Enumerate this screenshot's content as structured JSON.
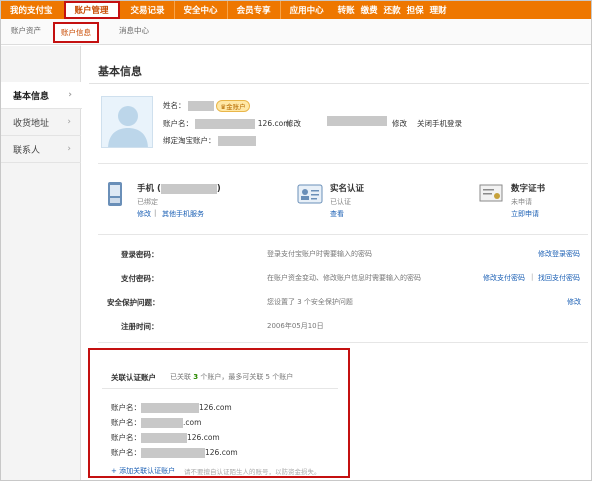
{
  "topnav": {
    "items": [
      "我的支付宝",
      "账户管理",
      "交易记录",
      "安全中心",
      "会员专享",
      "应用中心"
    ],
    "quick": [
      "转账",
      "缴费",
      "还款",
      "担保",
      "理财"
    ]
  },
  "subnav": {
    "items": [
      "账户资产",
      "账户信息",
      "消息中心"
    ]
  },
  "sidebar": {
    "items": [
      "基本信息",
      "收货地址",
      "联系人"
    ]
  },
  "page": {
    "title": "基本信息"
  },
  "profile": {
    "name_label": "姓名：",
    "level_badge": "金账户",
    "account_label": "账户名：",
    "account_suffix": "126.com",
    "modify": "修改",
    "close_phone_login": "关闭手机登录",
    "taobao_label": "绑定淘宝账户："
  },
  "features": {
    "phone": {
      "title": "手机 (",
      "title_end": ")",
      "status": "已绑定",
      "link1": "修改",
      "link2": "其他手机服务"
    },
    "realname": {
      "title": "实名认证",
      "status": "已认证",
      "link1": "查看"
    },
    "cert": {
      "title": "数字证书",
      "status": "未申请",
      "link1": "立即申请"
    }
  },
  "security": [
    {
      "label": "登录密码：",
      "desc": "登录支付宝账户时需要输入的密码",
      "a1": "",
      "a2": "修改登录密码"
    },
    {
      "label": "支付密码：",
      "desc": "在账户资金变动、修改账户信息时需要输入的密码",
      "a1": "修改支付密码",
      "a2": "找回支付密码"
    },
    {
      "label": "安全保护问题：",
      "desc": "您设置了 3 个安全保护问题",
      "a1": "",
      "a2": "修改"
    },
    {
      "label": "注册时间：",
      "desc": "2006年05月10日",
      "a1": "",
      "a2": ""
    }
  ],
  "linked": {
    "title": "关联认证账户",
    "sub_a": "已关联 ",
    "count": "3",
    "sub_b": " 个账户，最多可关联 5 个账户",
    "rows": [
      {
        "label": "账户名：",
        "suffix": "126.com"
      },
      {
        "label": "账户名：",
        "suffix": ".com"
      },
      {
        "label": "账户名：",
        "suffix": "126.com"
      },
      {
        "label": "账户名：",
        "suffix": "126.com"
      }
    ],
    "add": "+ 添加关联认证账户",
    "hint": "请不要擅自认证陌生人的账号，以防资金损失。"
  },
  "colors": {
    "nav_orange": "#ee7700",
    "highlight_red": "#c41010",
    "link_blue": "#1a5fb4"
  }
}
